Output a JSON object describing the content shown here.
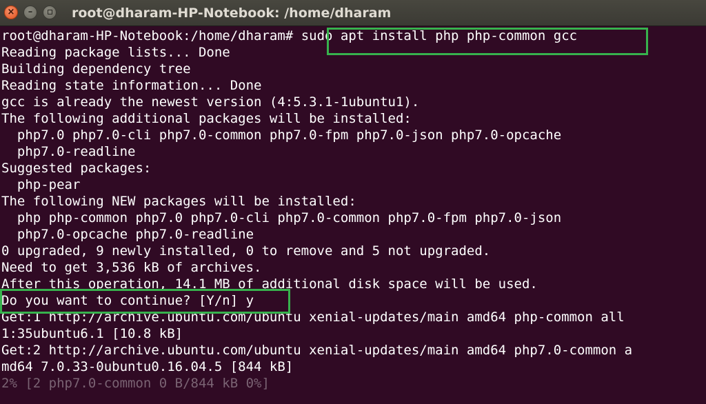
{
  "window": {
    "title": "root@dharam-HP-Notebook: /home/dharam",
    "close_glyph": "×",
    "minimize_glyph": "–"
  },
  "terminal": {
    "prompt": "root@dharam-HP-Notebook:/home/dharam#",
    "command": "sudo apt install php php-common gcc",
    "output": [
      "Reading package lists... Done",
      "Building dependency tree",
      "Reading state information... Done",
      "gcc is already the newest version (4:5.3.1-1ubuntu1).",
      "The following additional packages will be installed:",
      "  php7.0 php7.0-cli php7.0-common php7.0-fpm php7.0-json php7.0-opcache",
      "  php7.0-readline",
      "Suggested packages:",
      "  php-pear",
      "The following NEW packages will be installed:",
      "  php php-common php7.0 php7.0-cli php7.0-common php7.0-fpm php7.0-json",
      "  php7.0-opcache php7.0-readline",
      "0 upgraded, 9 newly installed, 0 to remove and 5 not upgraded.",
      "Need to get 3,536 kB of archives.",
      "After this operation, 14.1 MB of additional disk space will be used.",
      "Do you want to continue? [Y/n] y",
      "Get:1 http://archive.ubuntu.com/ubuntu xenial-updates/main amd64 php-common all",
      "1:35ubuntu6.1 [10.8 kB]",
      "Get:2 http://archive.ubuntu.com/ubuntu xenial-updates/main amd64 php7.0-common a",
      "md64 7.0.33-0ubuntu0.16.04.5 [844 kB]"
    ],
    "progress": "2% [2 php7.0-common 0 B/844 kB 0%]"
  },
  "colors": {
    "background": "#300a24",
    "text": "#ffffff",
    "highlight": "#37b24d"
  }
}
